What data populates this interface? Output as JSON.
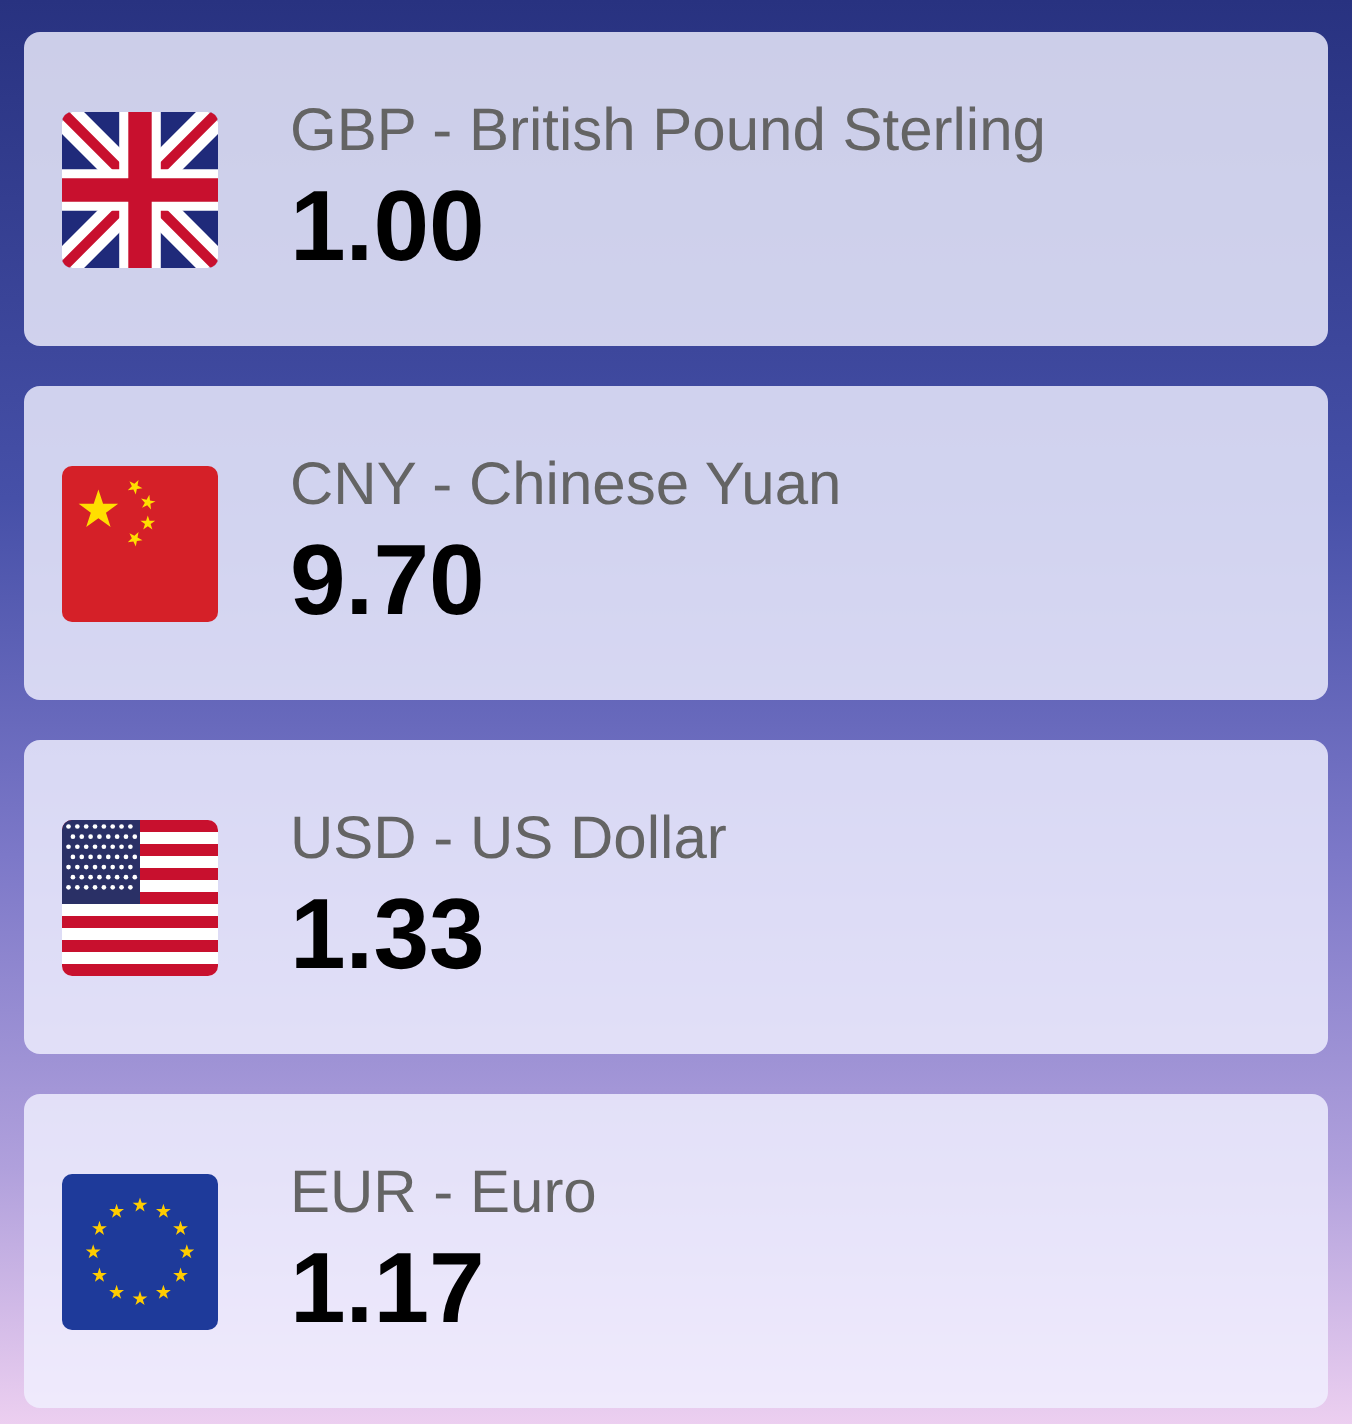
{
  "currencies": [
    {
      "kind": "gb",
      "name": "GBP - British Pound Sterling",
      "rate": "1.00"
    },
    {
      "kind": "cn",
      "name": "CNY - Chinese Yuan",
      "rate": "9.70"
    },
    {
      "kind": "us",
      "name": "USD - US Dollar",
      "rate": "1.33"
    },
    {
      "kind": "eu",
      "name": "EUR - Euro",
      "rate": "1.17"
    }
  ]
}
